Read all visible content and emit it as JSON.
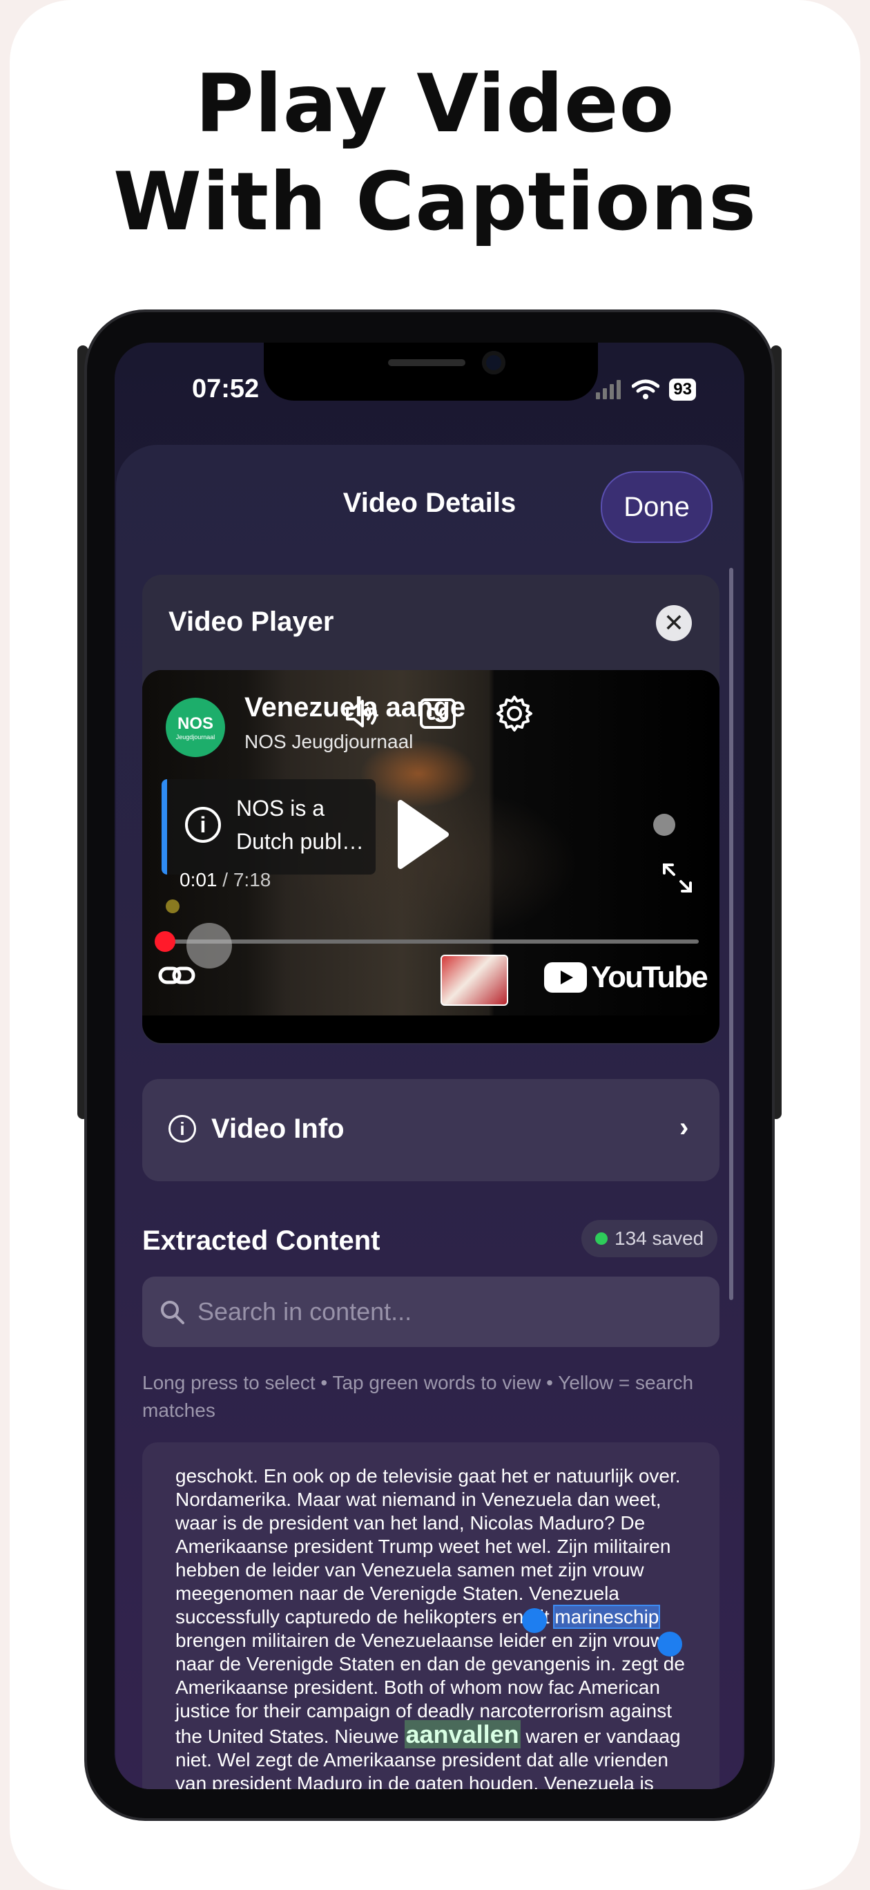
{
  "headline": {
    "line1": "Play Video",
    "line2": "With Captions"
  },
  "status_bar": {
    "time": "07:52",
    "battery": "93"
  },
  "sheet": {
    "title": "Video Details",
    "done_label": "Done"
  },
  "player": {
    "card_title": "Video Player",
    "video_title": "Venezuela aange",
    "channel": "NOS Jeugdjournaal",
    "channel_logo_text": "NOS",
    "channel_logo_sub": "Jeugdjournaal",
    "info_text": "NOS is a Dutch publ…",
    "current_time": "0:01",
    "duration": "/ 7:18",
    "progress_percent": 0.2,
    "brand": "YouTube"
  },
  "video_info": {
    "label": "Video Info"
  },
  "extracted": {
    "title": "Extracted Content",
    "saved_badge": "134 saved",
    "search_placeholder": "Search in content...",
    "hint": "Long press to select • Tap green words to view • Yellow = search matches",
    "text_before_highlight": "geschokt. En ook op de televisie gaat het er natuurlijk over.\nNordamerika. Maar wat niemand in Venezuela dan weet,\nwaar is de president van het land, Nicolas Maduro? De\nAmerikaanse president Trump weet het wel. Zijn militairen\nhebben de leider van Venezuela samen met zijn vrouw\nmeegenomen naar de Verenigde Staten. Venezuela\nsuccessfully capturedo de helikopters en dit ",
    "selected_word": "marineschip",
    "text_middle": "\nbrengen militairen de Venezuelaanse leider en zijn vrouw\nnaar de Verenigde Staten en dan de gevangenis in. zegt de\nAmerikaanse president. Both of whom now fac American\njustice for their campaign of deadly narcoterrorism against\nthe United States. Nieuwe ",
    "green_word": "aanvallen",
    "text_after": " waren er vandaag\nniet. Wel zegt de Amerikaanse president dat alle vrienden\nvan president Maduro in de gaten houden. Venezuela is"
  },
  "colors": {
    "accent": "#3a2f73",
    "selection": "#1e7ef0",
    "saved_dot": "#2ecc5a",
    "yt_red": "#ff0000"
  }
}
